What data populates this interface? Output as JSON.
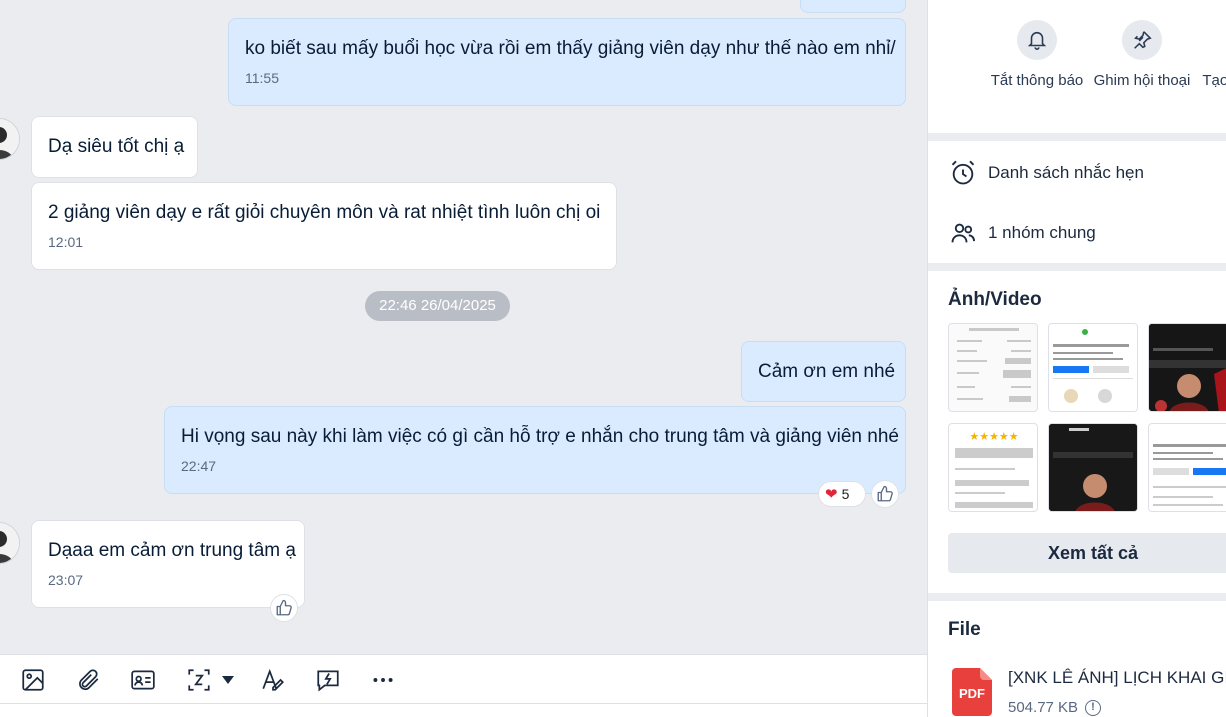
{
  "messages": [
    {
      "text": "ko biết sau mấy buổi học vừa rồi em thấy giảng viên dạy như thế nào em nhỉ/",
      "time": "11:55"
    },
    {
      "text": "Dạ siêu tốt chị ạ"
    },
    {
      "text": "2 giảng viên dạy e rất giỏi chuyên môn và rat nhiệt tình luôn chị oi",
      "time": "12:01"
    },
    {
      "text": "Cảm ơn em nhé"
    },
    {
      "text": "Hi vọng sau này khi làm việc có gì cần hỗ trợ e nhắn cho trung tâm và giảng viên nhé",
      "time": "22:47"
    },
    {
      "text": "Dạaa em cảm ơn trung tâm ạ",
      "time": "23:07"
    }
  ],
  "date_separator": "22:46 26/04/2025",
  "reaction": {
    "emoji": "❤️",
    "count": "5"
  },
  "toolbar": {
    "icons": [
      "image-icon",
      "attach-icon",
      "contact-card-icon",
      "screenshot-icon",
      "text-format-icon",
      "quick-message-icon",
      "more-icon"
    ]
  },
  "sidebar": {
    "quick_actions": [
      {
        "label": "Tắt thông báo",
        "icon": "bell-icon"
      },
      {
        "label": "Ghim hội thoại",
        "icon": "pin-icon"
      },
      {
        "label": "Tạo nhóm trò",
        "icon": "group-add-icon"
      }
    ],
    "reminders_label": "Danh sách nhắc hẹn",
    "common_groups_label": "1 nhóm chung",
    "media_title": "Ảnh/Video",
    "see_all_label": "Xem tất cả",
    "file_title": "File",
    "file": {
      "name": "[XNK LÊ ÁNH] LỊCH KHAI GIẢNG",
      "size": "504.77 KB",
      "type": "PDF"
    }
  },
  "colors": {
    "my_bubble": "#dbebff",
    "their_bubble": "#ffffff",
    "chat_bg": "#ebecf0",
    "accent": "#0068ff"
  }
}
